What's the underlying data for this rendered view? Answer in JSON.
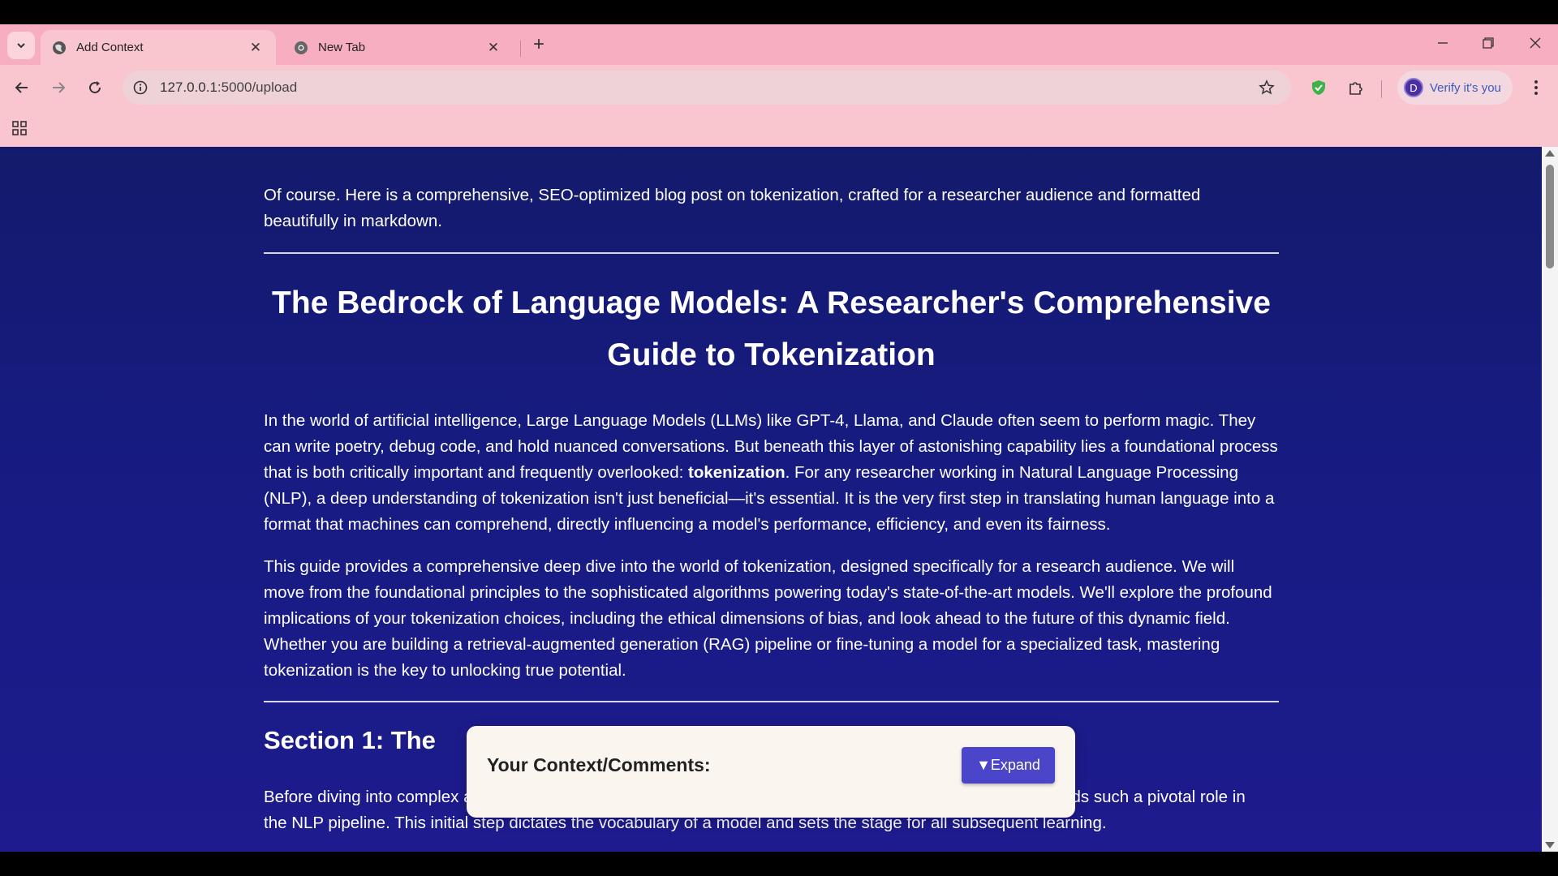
{
  "browser": {
    "tabs": [
      {
        "title": "Add Context",
        "active": true
      },
      {
        "title": "New Tab",
        "active": false
      }
    ],
    "url_host": "127.0.0.1",
    "url_path": ":5000/upload",
    "profile_initial": "D",
    "verify_label": "Verify it's you"
  },
  "article": {
    "intro": "Of course. Here is a comprehensive, SEO-optimized blog post on tokenization, crafted for a researcher audience and formatted beautifully in markdown.",
    "title": "The Bedrock of Language Models: A Researcher's Comprehensive Guide to Tokenization",
    "para1_a": "In the world of artificial intelligence, Large Language Models (LLMs) like GPT-4, Llama, and Claude often seem to perform magic. They can write poetry, debug code, and hold nuanced conversations. But beneath this layer of astonishing capability lies a foundational process that is both critically important and frequently overlooked: ",
    "para1_bold": "tokenization",
    "para1_b": ". For any researcher working in Natural Language Processing (NLP), a deep understanding of tokenization isn't just beneficial—it's essential. It is the very first step in translating human language into a format that machines can comprehend, directly influencing a model's performance, efficiency, and even its fairness.",
    "para2": "This guide provides a comprehensive deep dive into the world of tokenization, designed specifically for a research audience. We will move from the foundational principles to the sophisticated algorithms powering today's state-of-the-art models. We'll explore the profound implications of your tokenization choices, including the ethical dimensions of bias, and look ahead to the future of this dynamic field. Whether you are building a retrieval-augmented generation (RAG) pipeline or fine-tuning a model for a specialized task, mastering tokenization is the key to unlocking true potential.",
    "section1_heading": "Section 1: The",
    "para3_a": "Before diving into complex a",
    "para3_a_tail": "olds such a pivotal role in",
    "para3_b": "the NLP pipeline. This initial step dictates the vocabulary of a model and sets the stage for all subsequent learning."
  },
  "context_box": {
    "label": "Your Context/Comments:",
    "expand_label": "▼Expand"
  },
  "colors": {
    "page_bg": "#161b80",
    "chrome": "#f9c6d0",
    "expand_button": "#4b45c9"
  }
}
